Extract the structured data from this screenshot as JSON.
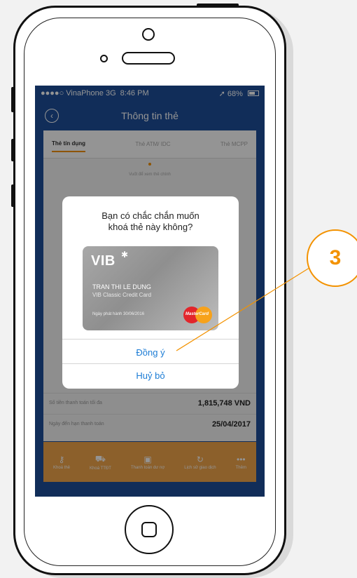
{
  "statusbar": {
    "carrier": "●●●●○ VinaPhone  3G",
    "time": "8:46 PM",
    "battery": "68%"
  },
  "navbar": {
    "title": "Thông tin thẻ"
  },
  "tabs": [
    "Thẻ tín dụng",
    "Thẻ ATM/ IDC",
    "Thẻ MCPP"
  ],
  "swipe_hint": "Vuốt để xem thẻ chính",
  "rows": [
    {
      "label": "Số tiền thanh toán tối đa",
      "value": "1,815,748 VND"
    },
    {
      "label": "Ngày đến hạn thanh toán",
      "value": "25/04/2017"
    }
  ],
  "bottom_actions": [
    {
      "icon": "key-icon",
      "label": "Khoá thẻ"
    },
    {
      "icon": "cart-icon",
      "label": "Khoá TTĐT"
    },
    {
      "icon": "payment-icon",
      "label": "Thanh toán dư nợ"
    },
    {
      "icon": "history-icon",
      "label": "Lịch sử giao dịch"
    },
    {
      "icon": "more-icon",
      "label": "Thêm"
    }
  ],
  "dialog": {
    "title_line1": "Bạn có chắc chắn muốn",
    "title_line2": "khoá thẻ này không?",
    "card": {
      "logo": "VIB",
      "holder": "TRAN THI LE DUNG",
      "type": "VIB Classic Credit Card",
      "issued": "Ngày phát hành 30/06/2016",
      "network": "MasterCard"
    },
    "confirm_label": "Đồng ý",
    "cancel_label": "Huỷ bỏ"
  },
  "annotation": {
    "number": "3",
    "color": "#f39200"
  },
  "colors": {
    "app_bar": "#1e4f9a",
    "accent": "#f39200",
    "link": "#1c7cd5"
  }
}
